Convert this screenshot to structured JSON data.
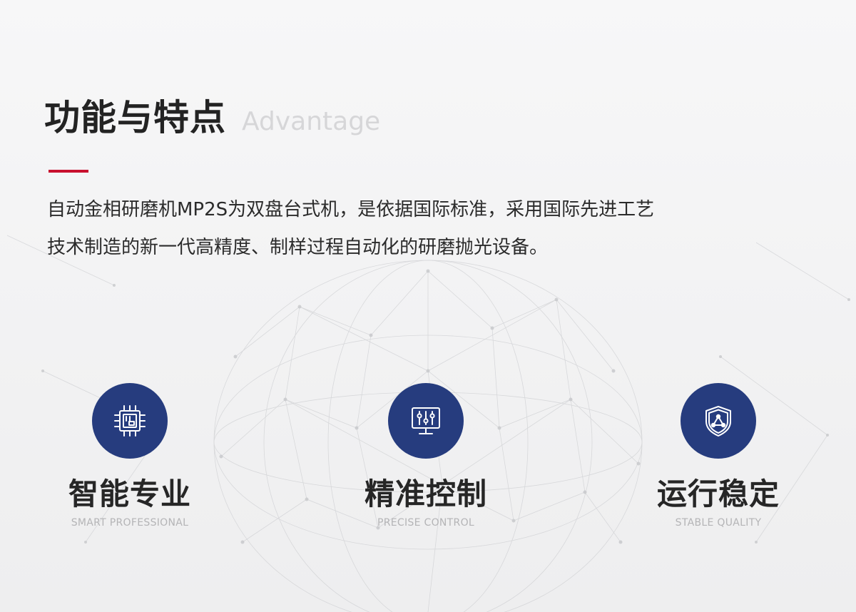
{
  "header": {
    "title_cn": "功能与特点",
    "title_en": "Advantage"
  },
  "intro": {
    "line1": "自动金相研磨机MP2S为双盘台式机，是依据国际标准，采用国际先进工艺",
    "line2": "技术制造的新一代高精度、制样过程自动化的研磨抛光设备。"
  },
  "features": [
    {
      "icon": "chip-icon",
      "name": "智能专业",
      "subtitle": "SMART PROFESSIONAL"
    },
    {
      "icon": "control-panel-icon",
      "name": "精准控制",
      "subtitle": "PRECISE CONTROL"
    },
    {
      "icon": "shield-icon",
      "name": "运行稳定",
      "subtitle": "STABLE QUALITY"
    }
  ],
  "colors": {
    "accent_red": "#c8102e",
    "icon_blue": "#263c7e",
    "title_dark": "#232323",
    "subtitle_gray": "#b4b4b6"
  }
}
